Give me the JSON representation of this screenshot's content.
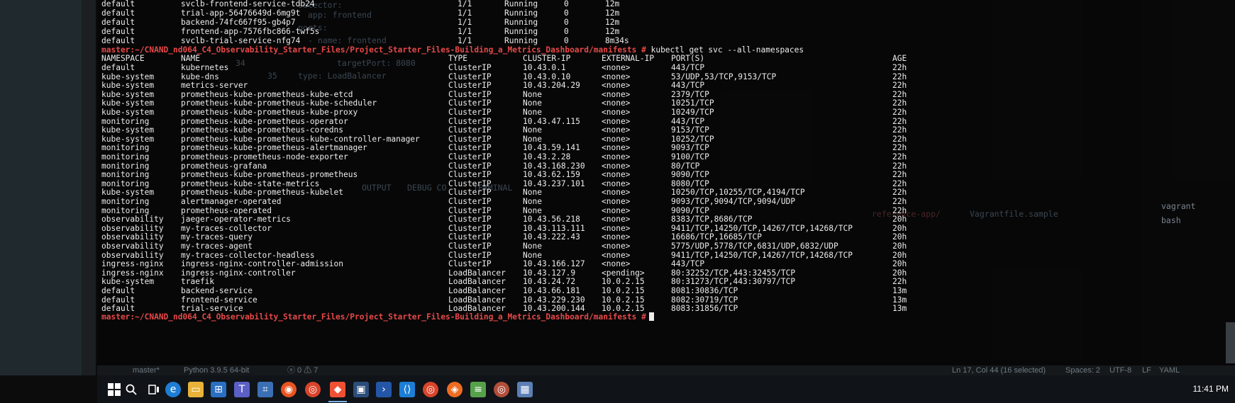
{
  "terminal": {
    "pods_tail": [
      [
        "default",
        "svclb-frontend-service-tdb24",
        "1/1",
        "Running",
        "0",
        "12m"
      ],
      [
        "default",
        "trial-app-56476649d-6mg9t",
        "1/1",
        "Running",
        "0",
        "12m"
      ],
      [
        "default",
        "backend-74fc667f95-gb4p7",
        "1/1",
        "Running",
        "0",
        "12m"
      ],
      [
        "default",
        "frontend-app-7576fbc866-twf5s",
        "1/1",
        "Running",
        "0",
        "12m"
      ],
      [
        "default",
        "svclb-trial-service-nfg74",
        "1/1",
        "Running",
        "0",
        "8m34s"
      ]
    ],
    "prompt": "master:~/CNAND_nd064_C4_Observability_Starter_Files/Project_Starter_Files-Building_a_Metrics_Dashboard/manifests #",
    "command": "kubectl get svc --all-namespaces",
    "svc_header": [
      "NAMESPACE",
      "NAME",
      "TYPE",
      "CLUSTER-IP",
      "EXTERNAL-IP",
      "PORT(S)",
      "AGE"
    ],
    "svc_rows": [
      [
        "default",
        "kubernetes",
        "ClusterIP",
        "10.43.0.1",
        "<none>",
        "443/TCP",
        "22h"
      ],
      [
        "kube-system",
        "kube-dns",
        "ClusterIP",
        "10.43.0.10",
        "<none>",
        "53/UDP,53/TCP,9153/TCP",
        "22h"
      ],
      [
        "kube-system",
        "metrics-server",
        "ClusterIP",
        "10.43.204.29",
        "<none>",
        "443/TCP",
        "22h"
      ],
      [
        "kube-system",
        "prometheus-kube-prometheus-kube-etcd",
        "ClusterIP",
        "None",
        "<none>",
        "2379/TCP",
        "22h"
      ],
      [
        "kube-system",
        "prometheus-kube-prometheus-kube-scheduler",
        "ClusterIP",
        "None",
        "<none>",
        "10251/TCP",
        "22h"
      ],
      [
        "kube-system",
        "prometheus-kube-prometheus-kube-proxy",
        "ClusterIP",
        "None",
        "<none>",
        "10249/TCP",
        "22h"
      ],
      [
        "monitoring",
        "prometheus-kube-prometheus-operator",
        "ClusterIP",
        "10.43.47.115",
        "<none>",
        "443/TCP",
        "22h"
      ],
      [
        "kube-system",
        "prometheus-kube-prometheus-coredns",
        "ClusterIP",
        "None",
        "<none>",
        "9153/TCP",
        "22h"
      ],
      [
        "kube-system",
        "prometheus-kube-prometheus-kube-controller-manager",
        "ClusterIP",
        "None",
        "<none>",
        "10252/TCP",
        "22h"
      ],
      [
        "monitoring",
        "prometheus-kube-prometheus-alertmanager",
        "ClusterIP",
        "10.43.59.141",
        "<none>",
        "9093/TCP",
        "22h"
      ],
      [
        "monitoring",
        "prometheus-prometheus-node-exporter",
        "ClusterIP",
        "10.43.2.28",
        "<none>",
        "9100/TCP",
        "22h"
      ],
      [
        "monitoring",
        "prometheus-grafana",
        "ClusterIP",
        "10.43.168.230",
        "<none>",
        "80/TCP",
        "22h"
      ],
      [
        "monitoring",
        "prometheus-kube-prometheus-prometheus",
        "ClusterIP",
        "10.43.62.159",
        "<none>",
        "9090/TCP",
        "22h"
      ],
      [
        "monitoring",
        "prometheus-kube-state-metrics",
        "ClusterIP",
        "10.43.237.101",
        "<none>",
        "8080/TCP",
        "22h"
      ],
      [
        "kube-system",
        "prometheus-kube-prometheus-kubelet",
        "ClusterIP",
        "None",
        "<none>",
        "10250/TCP,10255/TCP,4194/TCP",
        "22h"
      ],
      [
        "monitoring",
        "alertmanager-operated",
        "ClusterIP",
        "None",
        "<none>",
        "9093/TCP,9094/TCP,9094/UDP",
        "22h"
      ],
      [
        "monitoring",
        "prometheus-operated",
        "ClusterIP",
        "None",
        "<none>",
        "9090/TCP",
        "22h"
      ],
      [
        "observability",
        "jaeger-operator-metrics",
        "ClusterIP",
        "10.43.56.218",
        "<none>",
        "8383/TCP,8686/TCP",
        "20h"
      ],
      [
        "observability",
        "my-traces-collector",
        "ClusterIP",
        "10.43.113.111",
        "<none>",
        "9411/TCP,14250/TCP,14267/TCP,14268/TCP",
        "20h"
      ],
      [
        "observability",
        "my-traces-query",
        "ClusterIP",
        "10.43.222.43",
        "<none>",
        "16686/TCP,16685/TCP",
        "20h"
      ],
      [
        "observability",
        "my-traces-agent",
        "ClusterIP",
        "None",
        "<none>",
        "5775/UDP,5778/TCP,6831/UDP,6832/UDP",
        "20h"
      ],
      [
        "observability",
        "my-traces-collector-headless",
        "ClusterIP",
        "None",
        "<none>",
        "9411/TCP,14250/TCP,14267/TCP,14268/TCP",
        "20h"
      ],
      [
        "ingress-nginx",
        "ingress-nginx-controller-admission",
        "ClusterIP",
        "10.43.166.127",
        "<none>",
        "443/TCP",
        "20h"
      ],
      [
        "ingress-nginx",
        "ingress-nginx-controller",
        "LoadBalancer",
        "10.43.127.9",
        "<pending>",
        "80:32252/TCP,443:32455/TCP",
        "20h"
      ],
      [
        "kube-system",
        "traefik",
        "LoadBalancer",
        "10.43.24.72",
        "10.0.2.15",
        "80:31273/TCP,443:30797/TCP",
        "22h"
      ],
      [
        "default",
        "backend-service",
        "LoadBalancer",
        "10.43.66.181",
        "10.0.2.15",
        "8081:30836/TCP",
        "13m"
      ],
      [
        "default",
        "frontend-service",
        "LoadBalancer",
        "10.43.229.230",
        "10.0.2.15",
        "8082:30719/TCP",
        "13m"
      ],
      [
        "default",
        "trial-service",
        "LoadBalancer",
        "10.43.200.144",
        "10.0.2.15",
        "8083:31856/TCP",
        "13m"
      ]
    ]
  },
  "background_editor": {
    "yaml_lines": [
      "selector:",
      "app: frontend",
      "ports:",
      "- name: frontend",
      "targetPort: 8080",
      "type: LoadBalancer"
    ],
    "line_numbers": [
      "34",
      "35"
    ],
    "panel_tabs": [
      "OUTPUT",
      "DEBUG CO",
      "TERMINAL"
    ],
    "panel_path": "reference-app/",
    "panel_file": "Vagrantfile.sample",
    "right_panel_items": [
      "vagrant",
      "bash"
    ]
  },
  "statusbar": {
    "branch": "master*",
    "python": "Python 3.9.5 64-bit",
    "problems": "ⓧ 0 ⚠ 7",
    "position": "Ln 17, Col 44 (16 selected)",
    "spaces": "Spaces: 2",
    "encoding": "UTF-8",
    "eol": "LF",
    "language": "YAML"
  },
  "taskbar": {
    "clock": "11:41 PM",
    "icons": [
      "windows-start",
      "search",
      "task-view",
      "edge",
      "file-explorer",
      "store",
      "teams",
      "network",
      "ubuntu",
      "chrome",
      "git",
      "remote-desktop",
      "powershell",
      "vscode",
      "chrome",
      "brave",
      "notepad",
      "chrome-dev",
      "virtualbox"
    ]
  },
  "colors": {
    "prompt": "#e84848",
    "text": "#ececec",
    "terminal_bg": "#0c0c0c"
  }
}
